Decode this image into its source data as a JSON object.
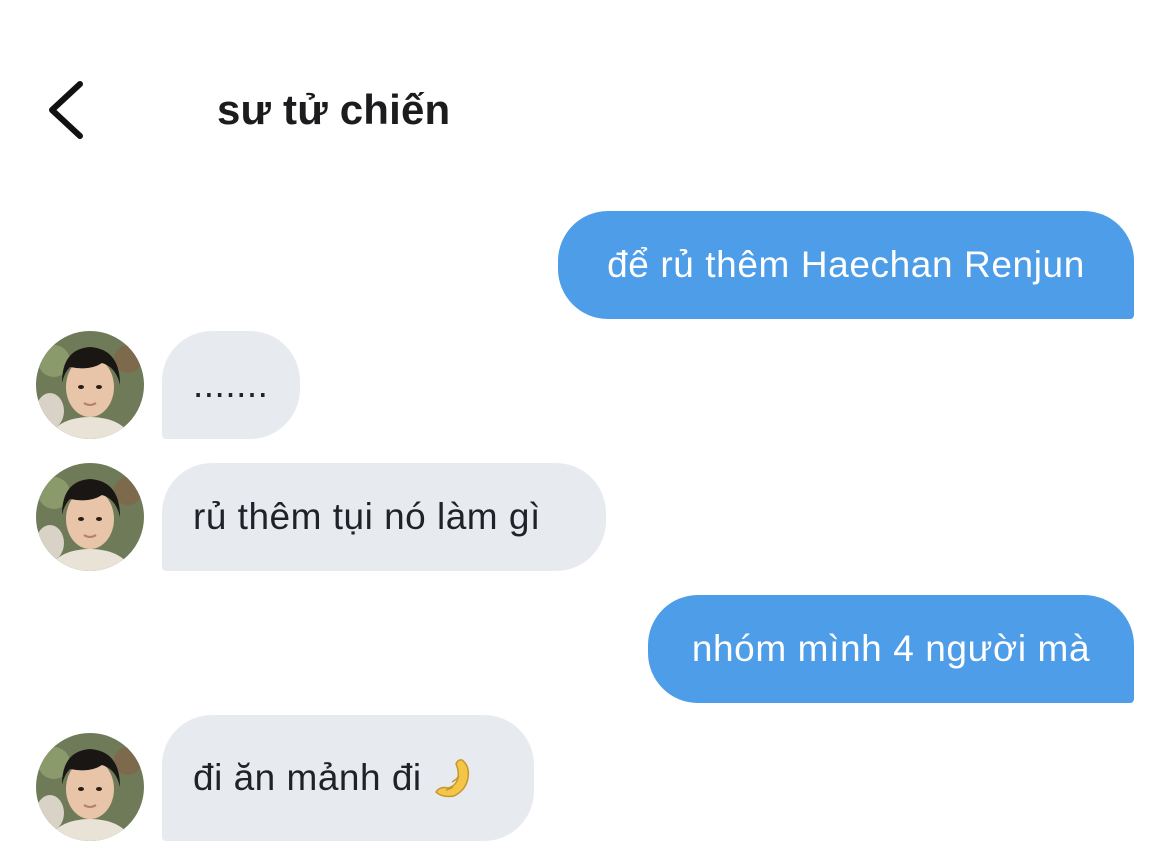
{
  "header": {
    "title": "sư tử chiến",
    "back_icon": "chevron-left-icon"
  },
  "colors": {
    "outgoing_bubble": "#4e9de8",
    "incoming_bubble": "#e7ebf0",
    "background": "#ffffff"
  },
  "messages": [
    {
      "direction": "outgoing",
      "text": "để rủ thêm Haechan Renjun"
    },
    {
      "direction": "incoming",
      "text": "......."
    },
    {
      "direction": "incoming",
      "text": "rủ thêm tụi nó làm gì"
    },
    {
      "direction": "outgoing",
      "text": "nhóm mình 4 người mà"
    },
    {
      "direction": "incoming",
      "text": "đi ăn mảnh đi",
      "emoji": "pinched-fingers-emoji"
    }
  ]
}
